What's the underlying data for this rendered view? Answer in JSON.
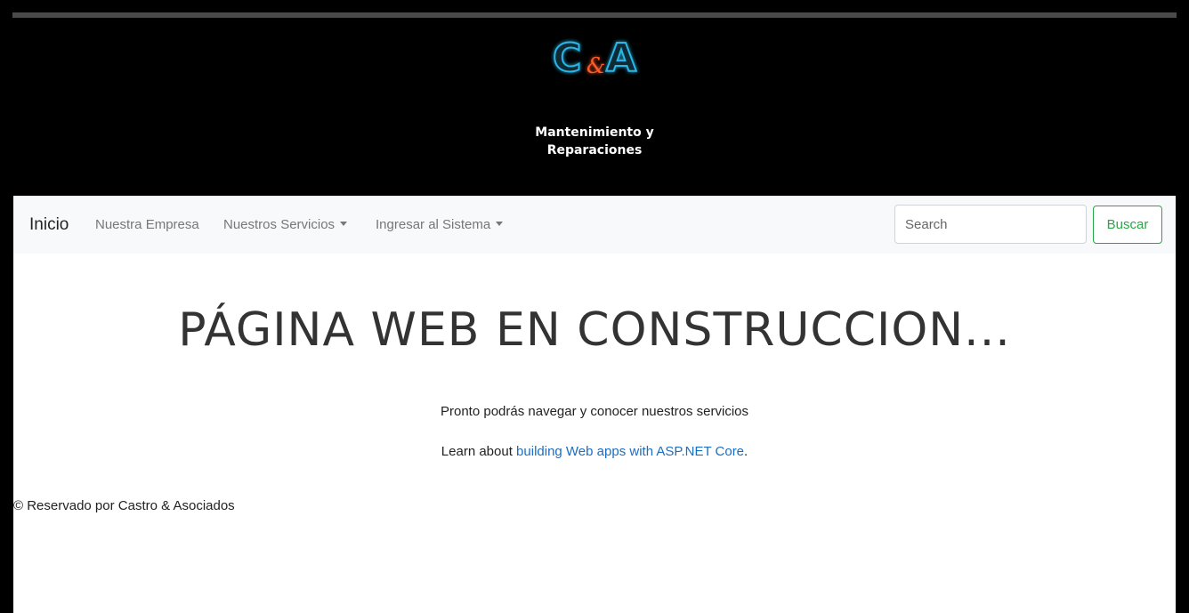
{
  "header": {
    "logo": {
      "letter_left": "C",
      "ampersand": "&",
      "letter_right": "A"
    },
    "tagline_line1": "Mantenimiento y",
    "tagline_line2": "Reparaciones"
  },
  "navbar": {
    "brand": "Inicio",
    "items": [
      {
        "label": "Nuestra Empresa",
        "dropdown": false
      },
      {
        "label": "Nuestros Servicios",
        "dropdown": true
      },
      {
        "label": "Ingresar al Sistema",
        "dropdown": true
      }
    ],
    "search": {
      "placeholder": "Search",
      "button_label": "Buscar"
    }
  },
  "main": {
    "title": "PÁGINA WEB EN CONSTRUCCION...",
    "intro": "Pronto podrás navegar y conocer nuestros servicios",
    "learn_prefix": "Learn about ",
    "learn_link": "building Web apps with ASP.NET Core",
    "learn_suffix": "."
  },
  "footer": {
    "text": "© Reservado por Castro & Asociados"
  },
  "colors": {
    "header_bg": "#000000",
    "navbar_bg": "#f8f9fa",
    "logo_blue": "#1fa7d6",
    "logo_orange": "#ff5a2a",
    "link": "#1b6ec2",
    "success": "#28a745"
  }
}
